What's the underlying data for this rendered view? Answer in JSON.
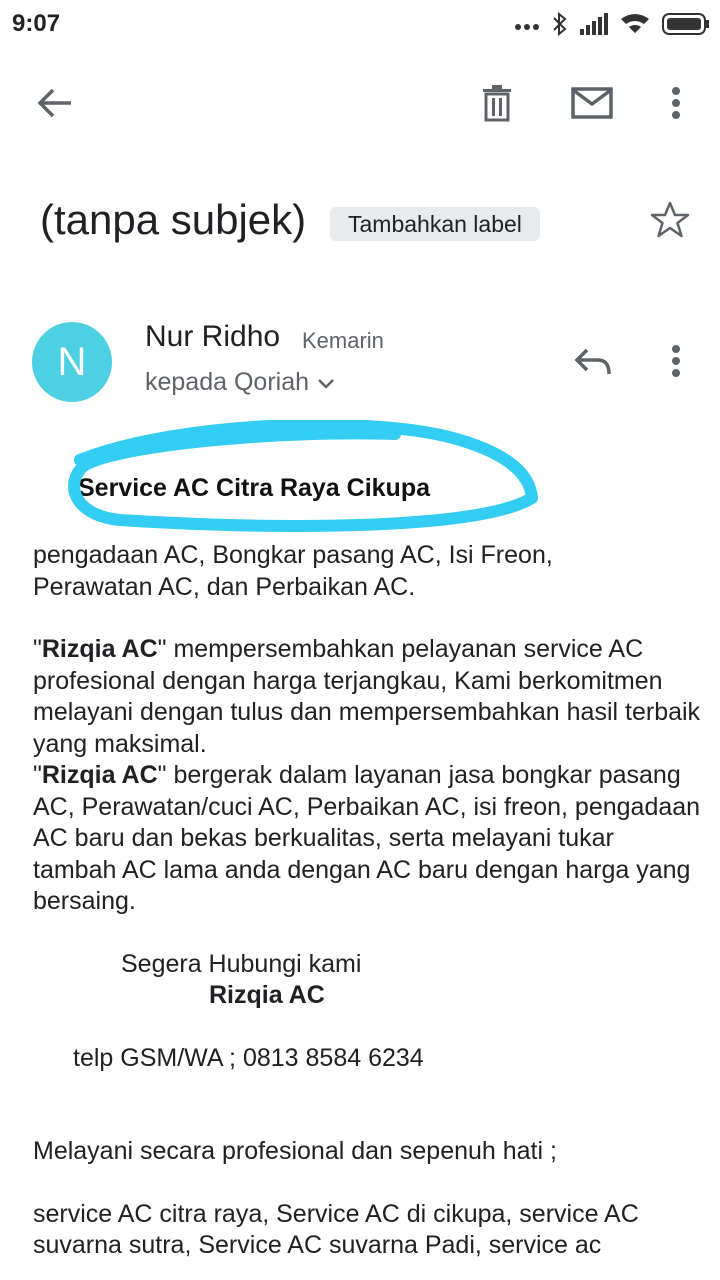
{
  "status": {
    "time": "9:07"
  },
  "email": {
    "subject": "(tanpa subjek)",
    "label_chip": "Tambahkan label",
    "sender": "Nur Ridho",
    "when": "Kemarin",
    "recipient": "kepada Qoriah",
    "avatar_initial": "N",
    "heading": "Service AC Citra Raya Cikupa",
    "line1": "pengadaan AC, Bongkar pasang AC, Isi Freon,",
    "line2": "Perawatan AC, dan Perbaikan AC.",
    "brand": "Rizqia AC",
    "p1_rest": " mempersembahkan pelayanan service AC profesional dengan harga terjangkau, Kami berkomitmen melayani dengan tulus dan mempersembahkan hasil terbaik yang maksimal.",
    "p2_rest": " bergerak dalam layanan jasa bongkar pasang AC, Perawatan/cuci AC, Perbaikan AC, isi freon, pengadaan AC baru dan bekas berkualitas, serta melayani tukar tambah AC lama anda dengan AC baru dengan harga yang bersaing.",
    "contact_intro": "Segera Hubungi kami",
    "contact_brand": "Rizqia AC",
    "phone": "telp GSM/WA ; 0813 8584 6234",
    "service_line": "Melayani secara profesional dan sepenuh hati ;",
    "tags": "service AC citra raya, Service AC di cikupa, service AC suvarna sutra, Service AC suvarna Padi, service ac"
  },
  "colors": {
    "avatar": "#4dd0e1",
    "highlight": "#33ccf2",
    "chip": "#e8eaed"
  }
}
